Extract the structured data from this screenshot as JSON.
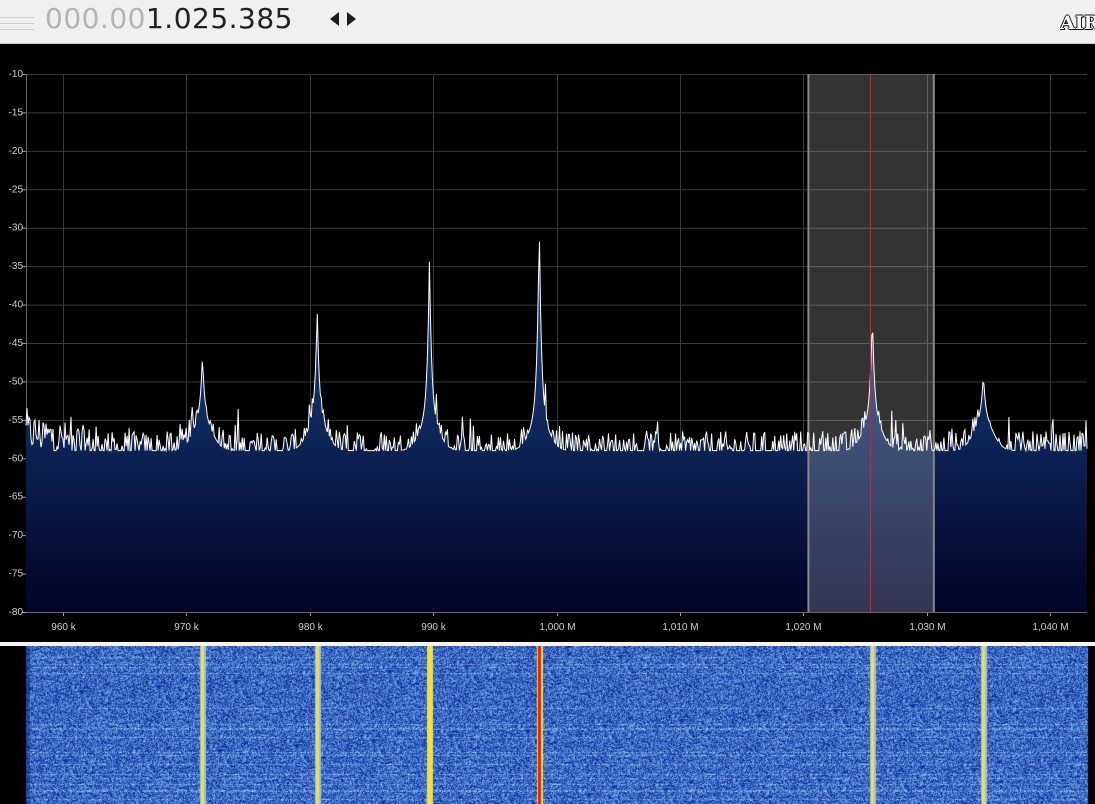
{
  "frequency": {
    "dim_part": "000.00",
    "bright_part": "1.025.385"
  },
  "logo_text": "AIR",
  "chart_data": {
    "type": "line",
    "title": "",
    "xlabel": "",
    "ylabel": "",
    "x_unit": "kHz",
    "xlim": [
      957,
      1043
    ],
    "ylim": [
      -80,
      -10
    ],
    "y_ticks": [
      -10,
      -15,
      -20,
      -25,
      -30,
      -35,
      -40,
      -45,
      -50,
      -55,
      -60,
      -65,
      -70,
      -75,
      -80
    ],
    "x_ticks": [
      {
        "value": 960,
        "label": "960 k"
      },
      {
        "value": 970,
        "label": "970 k"
      },
      {
        "value": 980,
        "label": "980 k"
      },
      {
        "value": 990,
        "label": "990 k"
      },
      {
        "value": 1000,
        "label": "1,000 M"
      },
      {
        "value": 1010,
        "label": "1,010 M"
      },
      {
        "value": 1020,
        "label": "1,020 M"
      },
      {
        "value": 1030,
        "label": "1,030 M"
      },
      {
        "value": 1040,
        "label": "1,040 M"
      }
    ],
    "grid": true,
    "noise_floor_db": -59,
    "peaks": [
      {
        "freq": 971.3,
        "db": -50.5
      },
      {
        "freq": 980.6,
        "db": -44.5
      },
      {
        "freq": 989.7,
        "db": -38
      },
      {
        "freq": 998.6,
        "db": -33
      },
      {
        "freq": 1025.6,
        "db": -45
      },
      {
        "freq": 1034.6,
        "db": -53
      }
    ],
    "passband_khz": [
      1020.5,
      1030.5
    ],
    "tuned_freq_khz": 1025.385,
    "colors": {
      "trace": "#ffffff",
      "fill_top": "#1a4a8e",
      "fill_bottom": "#020326",
      "tuner_line": "#e02020",
      "grid": "#3a3a3a"
    }
  },
  "waterfall": {
    "colors": {
      "background": "#0a1e8c",
      "mid": "#3c78d2",
      "high": "#bcd8f0",
      "peak_yellow": "#f0e040",
      "peak_red": "#e02010"
    }
  }
}
